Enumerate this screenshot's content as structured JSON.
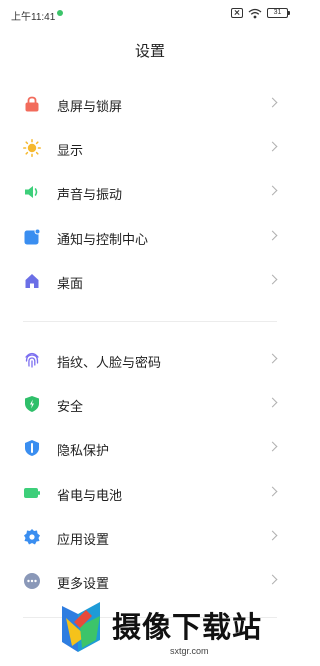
{
  "status_bar": {
    "time": "上午11:41",
    "battery": "31",
    "dot_color": "#3cc46a"
  },
  "title": "设置",
  "groups": [
    {
      "items": [
        {
          "label": "息屏与锁屏",
          "icon": "lock-icon",
          "color": "#f26b5b"
        },
        {
          "label": "显示",
          "icon": "sun-icon",
          "color": "#f5b82e"
        },
        {
          "label": "声音与振动",
          "icon": "speaker-icon",
          "color": "#3dcf7a"
        },
        {
          "label": "通知与控制中心",
          "icon": "notification-icon",
          "color": "#3a8ef0"
        },
        {
          "label": "桌面",
          "icon": "home-icon",
          "color": "#6b6fe6"
        }
      ]
    },
    {
      "items": [
        {
          "label": "指纹、人脸与密码",
          "icon": "fingerprint-icon",
          "color": "#7c6ff0"
        },
        {
          "label": "安全",
          "icon": "shield-icon",
          "color": "#2fbf6a"
        },
        {
          "label": "隐私保护",
          "icon": "privacy-icon",
          "color": "#3a8ef0"
        },
        {
          "label": "省电与电池",
          "icon": "battery-icon",
          "color": "#3dcf7a"
        },
        {
          "label": "应用设置",
          "icon": "gear-icon",
          "color": "#3a8ef0"
        },
        {
          "label": "更多设置",
          "icon": "more-icon",
          "color": "#8a98b8"
        }
      ]
    }
  ],
  "watermark": {
    "text": "摄像下载站",
    "url": "sxtgr.com"
  }
}
